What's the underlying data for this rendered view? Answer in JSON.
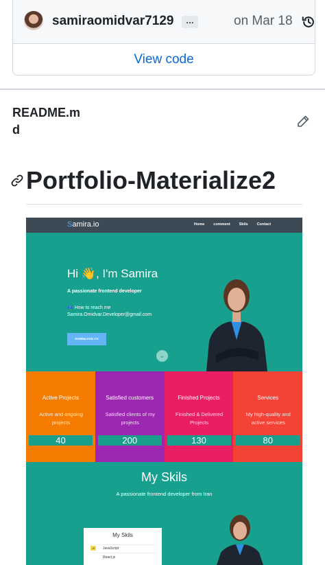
{
  "commit": {
    "username": "samiraomidvar7129",
    "more_label": "…",
    "date": "on Mar 18",
    "view_code_label": "View code"
  },
  "readme": {
    "filename": "README.md",
    "title": "Portfolio-Materialize2"
  },
  "preview": {
    "logo_initial": "S",
    "logo_rest": "amira.io",
    "nav_links": [
      "Home",
      "comment",
      "Skils",
      "Contact"
    ],
    "greeting": "Hi 👋, I'm Samira",
    "tagline": "A passionate frontend developer",
    "reach": "📪 How to reach me",
    "email": "Samira.Omidvar.Developer@gmail.com",
    "cv_button": "DOWNLOAD CV",
    "scroll_icon": "chevron-down-icon",
    "stats": [
      {
        "title": "Active Projects",
        "desc": "Active and ongoing projects",
        "value": "40",
        "color": "#f57c00"
      },
      {
        "title": "Satisfied customers",
        "desc": "Satisfied clients of my projects",
        "value": "200",
        "color": "#9c27b0"
      },
      {
        "title": "Finished Projects",
        "desc": "Finished & Delivered Projects",
        "value": "130",
        "color": "#e91e63"
      },
      {
        "title": "Services",
        "desc": "My high-quality and active services",
        "value": "80",
        "color": "#f44336"
      }
    ],
    "skills_title": "My Skils",
    "skills_subtitle": "A passionate frontend developer from Iran",
    "skills_card_title": "My Skils",
    "skills_list": [
      "JavaScript",
      "React js"
    ],
    "js_badge": "JS"
  },
  "colors": {
    "link": "#0969da",
    "teal": "#17a08e",
    "nav": "#3b4a55"
  }
}
